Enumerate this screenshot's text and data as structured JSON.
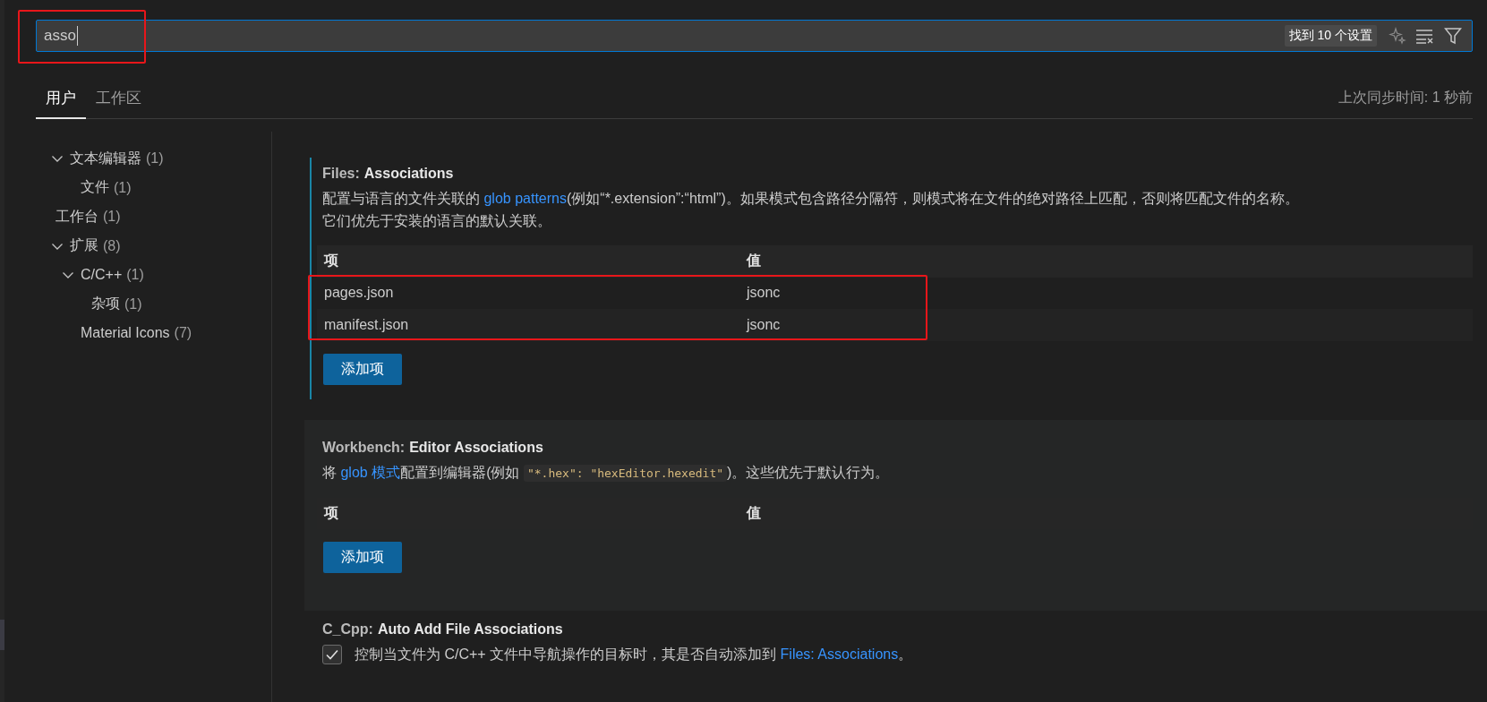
{
  "search": {
    "value": "asso",
    "result_count": "找到 10 个设置",
    "annotated": true
  },
  "tabs": [
    {
      "label": "用户",
      "selected": true
    },
    {
      "label": "工作区",
      "selected": false
    }
  ],
  "sync_status": "上次同步时间: 1 秒前",
  "tree": [
    {
      "label": "文本编辑器",
      "count": "(1)",
      "expanded": true,
      "children": [
        {
          "label": "文件",
          "count": "(1)"
        }
      ]
    },
    {
      "label": "工作台",
      "count": "(1)"
    },
    {
      "label": "扩展",
      "count": "(8)",
      "expanded": true,
      "children": [
        {
          "label": "C/C++",
          "count": "(1)",
          "expanded": true,
          "children": [
            {
              "label": "杂项",
              "count": "(1)"
            }
          ]
        },
        {
          "label": "Material Icons",
          "count": "(7)"
        }
      ]
    }
  ],
  "settings": [
    {
      "kind": "table",
      "focused": true,
      "highlighted": false,
      "category": "Files:",
      "name": "Associations",
      "description": [
        {
          "text": "配置与语言的文件关联的 "
        },
        {
          "kind": "link",
          "text": "glob patterns"
        },
        {
          "text": "(例如“*.extension”:“html”)。如果模式包含路径分隔符，则模式将在文件的绝对路径上匹配，否则将匹配文件的名称。它们优先于安装的语言的默认关联。"
        }
      ],
      "columns": [
        "项",
        "值"
      ],
      "rows": [
        [
          "pages.json",
          "jsonc"
        ],
        [
          "manifest.json",
          "jsonc"
        ]
      ],
      "rows_annotated": true,
      "button": "添加项"
    },
    {
      "kind": "table",
      "focused": false,
      "highlighted": true,
      "category": "Workbench:",
      "name": "Editor Associations",
      "description": [
        {
          "text": "将 "
        },
        {
          "kind": "link",
          "text": "glob 模式"
        },
        {
          "text": "配置到编辑器(例如 "
        },
        {
          "kind": "code",
          "text": "\"*.hex\": \"hexEditor.hexedit\""
        },
        {
          "text": ")。这些优先于默认行为。"
        }
      ],
      "columns": [
        "项",
        "值"
      ],
      "button": "添加项"
    },
    {
      "kind": "checkbox",
      "focused": false,
      "highlighted": false,
      "category": "C_Cpp:",
      "name": "Auto Add File Associations",
      "checked": true,
      "description": [
        {
          "text": "控制当文件为 C/C++ 文件中导航操作的目标时，其是否自动添加到 "
        },
        {
          "kind": "link",
          "text": "Files: Associations"
        },
        {
          "text": "。"
        }
      ]
    }
  ]
}
